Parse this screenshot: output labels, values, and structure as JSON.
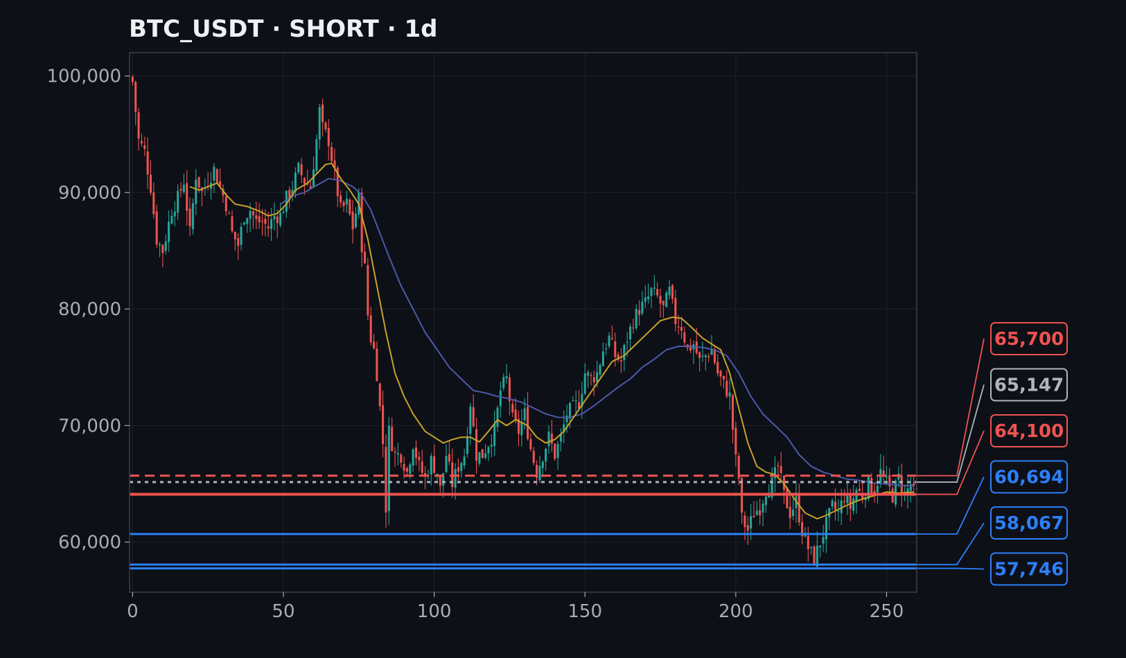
{
  "chart_data": {
    "type": "candlestick",
    "title": "BTC_USDT · SHORT · 1d",
    "xlabel": "",
    "ylabel": "",
    "xlim": [
      -1,
      260
    ],
    "ylim": [
      55700,
      102000
    ],
    "x_ticks": [
      0,
      50,
      100,
      150,
      200,
      250
    ],
    "y_ticks": [
      60000,
      70000,
      80000,
      90000,
      100000
    ],
    "grid": true,
    "candle_count": 261,
    "colors": {
      "background": "#0d1017",
      "grid": "#1e232c",
      "axis": "#3a3f48",
      "up": "#26a69a",
      "down": "#ef5350",
      "ma_fast": "#c9a227",
      "ma_slow": "#4d5aa8",
      "text": "#a9adb6",
      "title": "#eef0f4"
    },
    "close_path": [
      [
        0,
        99500
      ],
      [
        2,
        94500
      ],
      [
        4,
        93500
      ],
      [
        6,
        90500
      ],
      [
        8,
        86000
      ],
      [
        10,
        85000
      ],
      [
        13,
        88500
      ],
      [
        15,
        89500
      ],
      [
        17,
        91000
      ],
      [
        19,
        86500
      ],
      [
        21,
        91500
      ],
      [
        23,
        90000
      ],
      [
        25,
        91000
      ],
      [
        27,
        92000
      ],
      [
        29,
        90500
      ],
      [
        31,
        89000
      ],
      [
        33,
        86500
      ],
      [
        35,
        85500
      ],
      [
        37,
        88000
      ],
      [
        39,
        88500
      ],
      [
        41,
        87500
      ],
      [
        43,
        87500
      ],
      [
        45,
        87000
      ],
      [
        47,
        88000
      ],
      [
        49,
        88000
      ],
      [
        51,
        89500
      ],
      [
        53,
        90500
      ],
      [
        55,
        92000
      ],
      [
        57,
        91000
      ],
      [
        59,
        90500
      ],
      [
        61,
        94500
      ],
      [
        62,
        97000
      ],
      [
        63,
        95500
      ],
      [
        65,
        94500
      ],
      [
        67,
        91500
      ],
      [
        69,
        88500
      ],
      [
        71,
        89000
      ],
      [
        73,
        87000
      ],
      [
        75,
        89500
      ],
      [
        76,
        85500
      ],
      [
        77,
        83500
      ],
      [
        78,
        79500
      ],
      [
        79,
        77500
      ],
      [
        80,
        76500
      ],
      [
        81,
        74500
      ],
      [
        82,
        71500
      ],
      [
        83,
        68500
      ],
      [
        84,
        63000
      ],
      [
        85,
        69500
      ],
      [
        87,
        67500
      ],
      [
        89,
        67500
      ],
      [
        91,
        66000
      ],
      [
        93,
        68500
      ],
      [
        95,
        66500
      ],
      [
        97,
        65500
      ],
      [
        99,
        67000
      ],
      [
        101,
        66000
      ],
      [
        102,
        64500
      ],
      [
        104,
        67500
      ],
      [
        106,
        65000
      ],
      [
        108,
        66500
      ],
      [
        110,
        67500
      ],
      [
        112,
        72000
      ],
      [
        114,
        67500
      ],
      [
        116,
        67500
      ],
      [
        118,
        68500
      ],
      [
        120,
        69500
      ],
      [
        122,
        73000
      ],
      [
        124,
        74000
      ],
      [
        126,
        70500
      ],
      [
        128,
        69500
      ],
      [
        130,
        71000
      ],
      [
        132,
        68000
      ],
      [
        134,
        66000
      ],
      [
        136,
        67500
      ],
      [
        138,
        69000
      ],
      [
        140,
        67500
      ],
      [
        142,
        69000
      ],
      [
        144,
        71000
      ],
      [
        146,
        71500
      ],
      [
        148,
        72000
      ],
      [
        150,
        74500
      ],
      [
        152,
        74000
      ],
      [
        154,
        74500
      ],
      [
        156,
        76500
      ],
      [
        158,
        77500
      ],
      [
        160,
        76000
      ],
      [
        162,
        75500
      ],
      [
        164,
        77500
      ],
      [
        166,
        79000
      ],
      [
        168,
        80000
      ],
      [
        170,
        80500
      ],
      [
        172,
        81500
      ],
      [
        174,
        81000
      ],
      [
        176,
        80000
      ],
      [
        178,
        81500
      ],
      [
        180,
        79000
      ],
      [
        182,
        78500
      ],
      [
        184,
        76500
      ],
      [
        186,
        77000
      ],
      [
        188,
        75500
      ],
      [
        190,
        76000
      ],
      [
        192,
        76500
      ],
      [
        194,
        74500
      ],
      [
        196,
        73500
      ],
      [
        198,
        72500
      ],
      [
        200,
        67000
      ],
      [
        201,
        65500
      ],
      [
        202,
        62000
      ],
      [
        204,
        61000
      ],
      [
        206,
        62500
      ],
      [
        208,
        63000
      ],
      [
        210,
        64500
      ],
      [
        212,
        65000
      ],
      [
        214,
        66500
      ],
      [
        216,
        64000
      ],
      [
        218,
        62500
      ],
      [
        220,
        63500
      ],
      [
        222,
        61000
      ],
      [
        224,
        59500
      ],
      [
        226,
        58500
      ],
      [
        228,
        60000
      ],
      [
        230,
        61500
      ],
      [
        232,
        63000
      ],
      [
        234,
        62500
      ],
      [
        236,
        64000
      ],
      [
        238,
        63000
      ],
      [
        240,
        64500
      ],
      [
        242,
        64000
      ],
      [
        244,
        65000
      ],
      [
        246,
        64500
      ],
      [
        248,
        66000
      ],
      [
        250,
        65000
      ],
      [
        252,
        64000
      ],
      [
        254,
        65500
      ],
      [
        256,
        64000
      ],
      [
        258,
        65000
      ],
      [
        259,
        64200
      ]
    ],
    "ma_fast": [
      [
        19,
        90500
      ],
      [
        22,
        90200
      ],
      [
        25,
        90500
      ],
      [
        28,
        90800
      ],
      [
        31,
        89800
      ],
      [
        34,
        89000
      ],
      [
        38,
        88800
      ],
      [
        42,
        88400
      ],
      [
        45,
        88000
      ],
      [
        48,
        88200
      ],
      [
        51,
        89000
      ],
      [
        54,
        90200
      ],
      [
        58,
        90800
      ],
      [
        61,
        91600
      ],
      [
        64,
        92400
      ],
      [
        66,
        92500
      ],
      [
        69,
        91200
      ],
      [
        72,
        90200
      ],
      [
        75,
        89000
      ],
      [
        78,
        86000
      ],
      [
        81,
        82000
      ],
      [
        84,
        78000
      ],
      [
        87,
        74500
      ],
      [
        90,
        72500
      ],
      [
        93,
        71000
      ],
      [
        97,
        69500
      ],
      [
        100,
        69000
      ],
      [
        103,
        68500
      ],
      [
        106,
        68800
      ],
      [
        109,
        69000
      ],
      [
        112,
        69000
      ],
      [
        115,
        68600
      ],
      [
        118,
        69500
      ],
      [
        121,
        70500
      ],
      [
        124,
        70000
      ],
      [
        127,
        70500
      ],
      [
        131,
        70000
      ],
      [
        134,
        69000
      ],
      [
        137,
        68500
      ],
      [
        140,
        68800
      ],
      [
        143,
        69500
      ],
      [
        147,
        71000
      ],
      [
        151,
        72500
      ],
      [
        155,
        74000
      ],
      [
        159,
        75500
      ],
      [
        163,
        76000
      ],
      [
        167,
        77000
      ],
      [
        171,
        78000
      ],
      [
        175,
        79000
      ],
      [
        179,
        79300
      ],
      [
        182,
        79200
      ],
      [
        185,
        78500
      ],
      [
        189,
        77500
      ],
      [
        192,
        77000
      ],
      [
        195,
        76500
      ],
      [
        198,
        74500
      ],
      [
        201,
        71500
      ],
      [
        204,
        68500
      ],
      [
        207,
        66500
      ],
      [
        210,
        66000
      ],
      [
        213,
        65800
      ],
      [
        216,
        65000
      ],
      [
        220,
        63500
      ],
      [
        223,
        62500
      ],
      [
        227,
        62000
      ],
      [
        230,
        62300
      ],
      [
        234,
        62800
      ],
      [
        238,
        63300
      ],
      [
        242,
        63700
      ],
      [
        246,
        64000
      ],
      [
        250,
        64300
      ],
      [
        254,
        64200
      ],
      [
        259,
        64300
      ]
    ],
    "ma_slow": [
      [
        49,
        89000
      ],
      [
        53,
        89700
      ],
      [
        57,
        90000
      ],
      [
        61,
        90600
      ],
      [
        65,
        91200
      ],
      [
        69,
        91000
      ],
      [
        73,
        90500
      ],
      [
        76,
        89800
      ],
      [
        79,
        88500
      ],
      [
        82,
        86500
      ],
      [
        85,
        84500
      ],
      [
        89,
        82000
      ],
      [
        93,
        80000
      ],
      [
        97,
        78000
      ],
      [
        101,
        76500
      ],
      [
        105,
        75000
      ],
      [
        109,
        74000
      ],
      [
        113,
        73000
      ],
      [
        117,
        72800
      ],
      [
        121,
        72500
      ],
      [
        125,
        72300
      ],
      [
        129,
        72000
      ],
      [
        133,
        71500
      ],
      [
        137,
        71000
      ],
      [
        141,
        70700
      ],
      [
        145,
        70700
      ],
      [
        149,
        71000
      ],
      [
        153,
        71700
      ],
      [
        157,
        72500
      ],
      [
        161,
        73300
      ],
      [
        165,
        74000
      ],
      [
        169,
        75000
      ],
      [
        173,
        75700
      ],
      [
        177,
        76500
      ],
      [
        181,
        76800
      ],
      [
        185,
        76800
      ],
      [
        189,
        76700
      ],
      [
        193,
        76500
      ],
      [
        197,
        76000
      ],
      [
        201,
        74500
      ],
      [
        205,
        72500
      ],
      [
        209,
        71000
      ],
      [
        213,
        70000
      ],
      [
        217,
        69000
      ],
      [
        221,
        67500
      ],
      [
        225,
        66500
      ],
      [
        229,
        66000
      ],
      [
        233,
        65700
      ],
      [
        237,
        65400
      ],
      [
        241,
        65300
      ],
      [
        245,
        65100
      ],
      [
        249,
        65000
      ],
      [
        254,
        64900
      ],
      [
        259,
        64800
      ]
    ],
    "levels": [
      {
        "value": 65700,
        "label": "65,700",
        "color": "#ef5350",
        "style": "dashed",
        "line_width": 3
      },
      {
        "value": 65147,
        "label": "65,147",
        "color": "#b0b4bc",
        "style": "dotted",
        "line_width": 3
      },
      {
        "value": 64100,
        "label": "64,100",
        "color": "#ef5350",
        "style": "solid",
        "line_width": 4
      },
      {
        "value": 60694,
        "label": "60,694",
        "color": "#2d7ff9",
        "style": "solid",
        "line_width": 3
      },
      {
        "value": 58067,
        "label": "58,067",
        "color": "#2d7ff9",
        "style": "solid",
        "line_width": 3
      },
      {
        "value": 57746,
        "label": "57,746",
        "color": "#2d7ff9",
        "style": "solid",
        "line_width": 3
      }
    ]
  }
}
